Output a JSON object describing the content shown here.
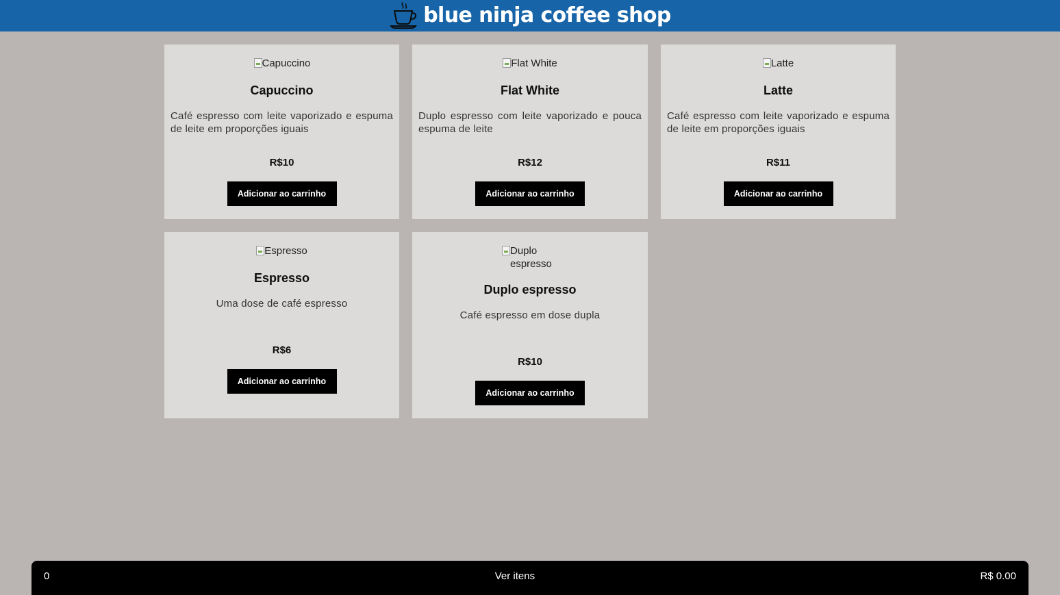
{
  "header": {
    "title": "blue ninja coffee shop",
    "icon": "coffee-cup-icon"
  },
  "products": [
    {
      "image_alt": "Capuccino",
      "name": "Capuccino",
      "description": "Café espresso com leite vaporizado e espuma de leite em proporções iguais",
      "price": "R$10",
      "button_label": "Adicionar ao carrinho"
    },
    {
      "image_alt": "Flat White",
      "name": "Flat White",
      "description": "Duplo espresso com leite vaporizado e pouca espuma de leite",
      "price": "R$12",
      "button_label": "Adicionar ao carrinho"
    },
    {
      "image_alt": "Latte",
      "name": "Latte",
      "description": "Café espresso com leite vaporizado e espuma de leite em proporções iguais",
      "price": "R$11",
      "button_label": "Adicionar ao carrinho"
    },
    {
      "image_alt": "Espresso",
      "name": "Espresso",
      "description": "Uma dose de café espresso",
      "price": "R$6",
      "button_label": "Adicionar ao carrinho"
    },
    {
      "image_alt": "Duplo espresso",
      "name": "Duplo espresso",
      "description": "Café espresso em dose dupla",
      "price": "R$10",
      "button_label": "Adicionar ao carrinho"
    }
  ],
  "cart": {
    "count": "0",
    "view_label": "Ver itens",
    "total": "R$ 0.00"
  },
  "colors": {
    "header_bg": "#1765a8",
    "page_bg": "#bab4b3",
    "card_bg": "#dcdbda",
    "button_bg": "#000000"
  }
}
